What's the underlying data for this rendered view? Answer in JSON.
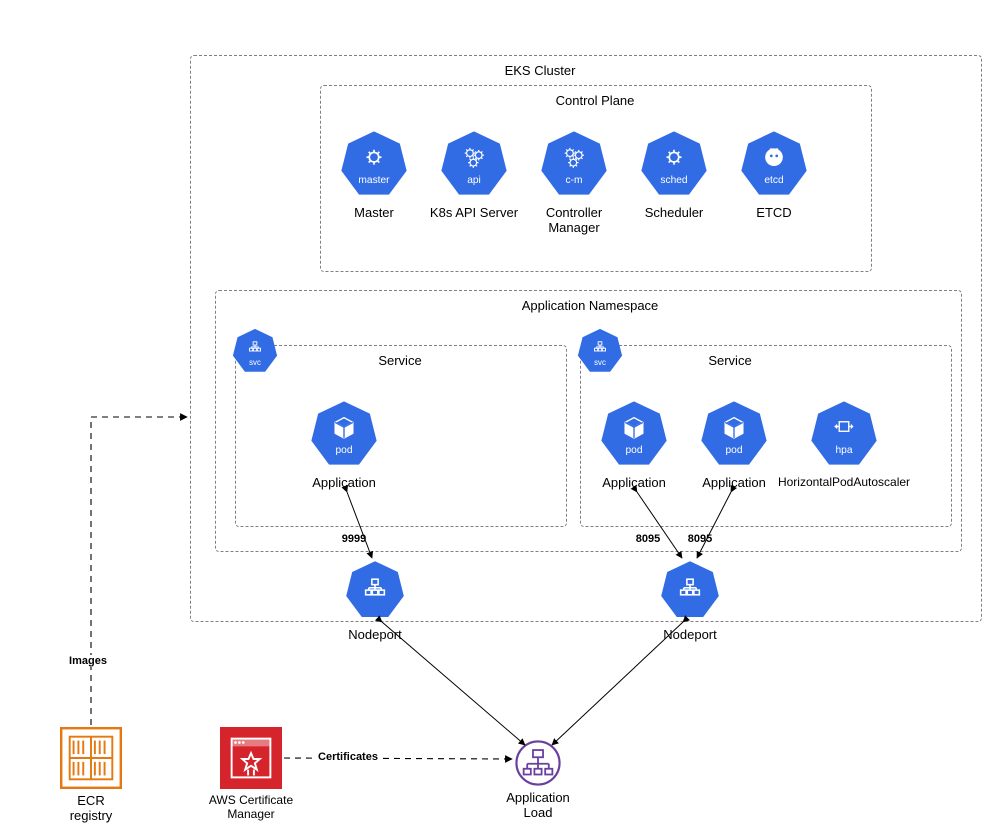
{
  "cluster": {
    "title": "EKS Cluster",
    "control_plane": {
      "title": "Control Plane",
      "nodes": [
        {
          "tag": "master",
          "label": "Master"
        },
        {
          "tag": "api",
          "label": "K8s API Server"
        },
        {
          "tag": "c-m",
          "label": "Controller Manager"
        },
        {
          "tag": "sched",
          "label": "Scheduler"
        },
        {
          "tag": "etcd",
          "label": "ETCD"
        }
      ]
    },
    "app_ns": {
      "title": "Application Namespace",
      "svc_badge": "svc",
      "services": [
        {
          "title": "Service",
          "pods": [
            {
              "tag": "pod",
              "label": "Application"
            }
          ],
          "port": "9999"
        },
        {
          "title": "Service",
          "pods": [
            {
              "tag": "pod",
              "label": "Application"
            },
            {
              "tag": "pod",
              "label": "Application"
            }
          ],
          "hpa": {
            "tag": "hpa",
            "label": "HorizontalPodAutoscaler"
          },
          "ports": [
            "8095",
            "8095"
          ]
        }
      ]
    }
  },
  "nodeports": [
    {
      "label": "Nodeport"
    },
    {
      "label": "Nodeport"
    }
  ],
  "ecr": {
    "label": "ECR registry"
  },
  "acm": {
    "label": "AWS Certificate Manager"
  },
  "alb": {
    "label": "Application Load"
  },
  "edges": {
    "images": "Images",
    "certs": "Certificates"
  }
}
